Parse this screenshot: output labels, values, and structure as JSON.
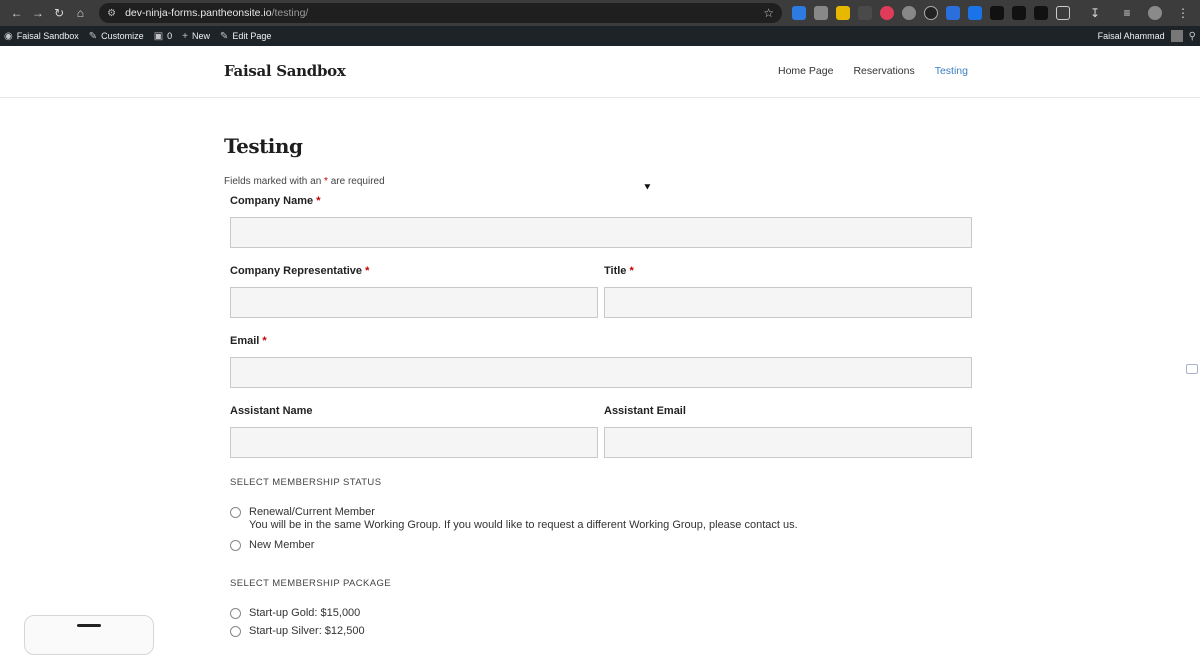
{
  "browser": {
    "url_domain": "dev-ninja-forms.pantheonsite.io",
    "url_path": "/testing/"
  },
  "adminbar": {
    "site": "Faisal Sandbox",
    "customize": "Customize",
    "comments": "0",
    "new": "New",
    "edit": "Edit Page",
    "user": "Faisal Ahammad"
  },
  "header": {
    "title": "Faisal Sandbox",
    "menu": [
      "Home Page",
      "Reservations",
      "Testing"
    ]
  },
  "page": {
    "title": "Testing",
    "note_prefix": "Fields marked with an",
    "note_star": "*",
    "note_suffix": "are required"
  },
  "form": {
    "company_name": "Company Name",
    "company_rep": "Company Representative",
    "title": "Title",
    "email": "Email",
    "assistant_name": "Assistant Name",
    "assistant_email": "Assistant Email",
    "req_star": "*",
    "membership_status": {
      "label": "SELECT MEMBERSHIP STATUS",
      "options": [
        {
          "label": "Renewal/Current Member",
          "desc": "You will be in the same Working Group. If you would like to request a different Working Group, please contact us."
        },
        {
          "label": "New Member",
          "desc": ""
        }
      ]
    },
    "membership_package": {
      "label": "SELECT MEMBERSHIP PACKAGE",
      "options": [
        {
          "label": "Start-up Gold: $15,000"
        },
        {
          "label": "Start-up Silver: $12,500"
        }
      ]
    }
  }
}
